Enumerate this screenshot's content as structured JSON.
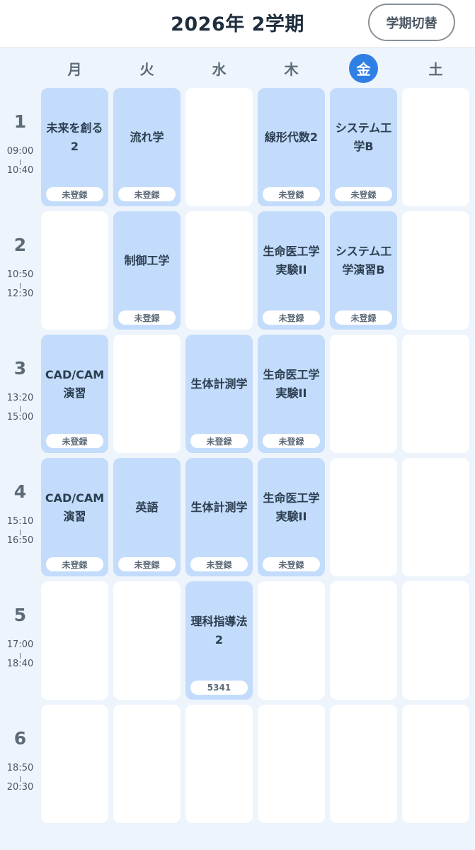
{
  "header": {
    "title": "2026年 2学期",
    "term_switch_label": "学期切替"
  },
  "days": [
    "月",
    "火",
    "水",
    "木",
    "金",
    "土"
  ],
  "today_index": 4,
  "periods": [
    {
      "num": "1",
      "start": "09:00",
      "end": "10:40"
    },
    {
      "num": "2",
      "start": "10:50",
      "end": "12:30"
    },
    {
      "num": "3",
      "start": "13:20",
      "end": "15:00"
    },
    {
      "num": "4",
      "start": "15:10",
      "end": "16:50"
    },
    {
      "num": "5",
      "start": "17:00",
      "end": "18:40"
    },
    {
      "num": "6",
      "start": "18:50",
      "end": "20:30"
    }
  ],
  "grid": [
    [
      {
        "name": "未来を創る2",
        "badge": "未登録"
      },
      {
        "name": "流れ学",
        "badge": "未登録"
      },
      null,
      {
        "name": "線形代数2",
        "badge": "未登録"
      },
      {
        "name": "システム工学B",
        "badge": "未登録"
      },
      null
    ],
    [
      null,
      {
        "name": "制御工学",
        "badge": "未登録"
      },
      null,
      {
        "name": "生命医工学実験II",
        "badge": "未登録"
      },
      {
        "name": "システム工学演習B",
        "badge": "未登録"
      },
      null
    ],
    [
      {
        "name": "CAD/CAM演習",
        "badge": "未登録"
      },
      null,
      {
        "name": "生体計測学",
        "badge": "未登録"
      },
      {
        "name": "生命医工学実験II",
        "badge": "未登録"
      },
      null,
      null
    ],
    [
      {
        "name": "CAD/CAM演習",
        "badge": "未登録"
      },
      {
        "name": "英語",
        "badge": "未登録"
      },
      {
        "name": "生体計測学",
        "badge": "未登録"
      },
      {
        "name": "生命医工学実験II",
        "badge": "未登録"
      },
      null,
      null
    ],
    [
      null,
      null,
      {
        "name": "理科指導法2",
        "badge": "5341"
      },
      null,
      null,
      null
    ],
    [
      null,
      null,
      null,
      null,
      null,
      null
    ]
  ],
  "colors": {
    "background": "#eef4fb",
    "filled_cell": "#c3dcfb",
    "empty_cell": "#ffffff",
    "today_accent": "#2f7fe4"
  }
}
